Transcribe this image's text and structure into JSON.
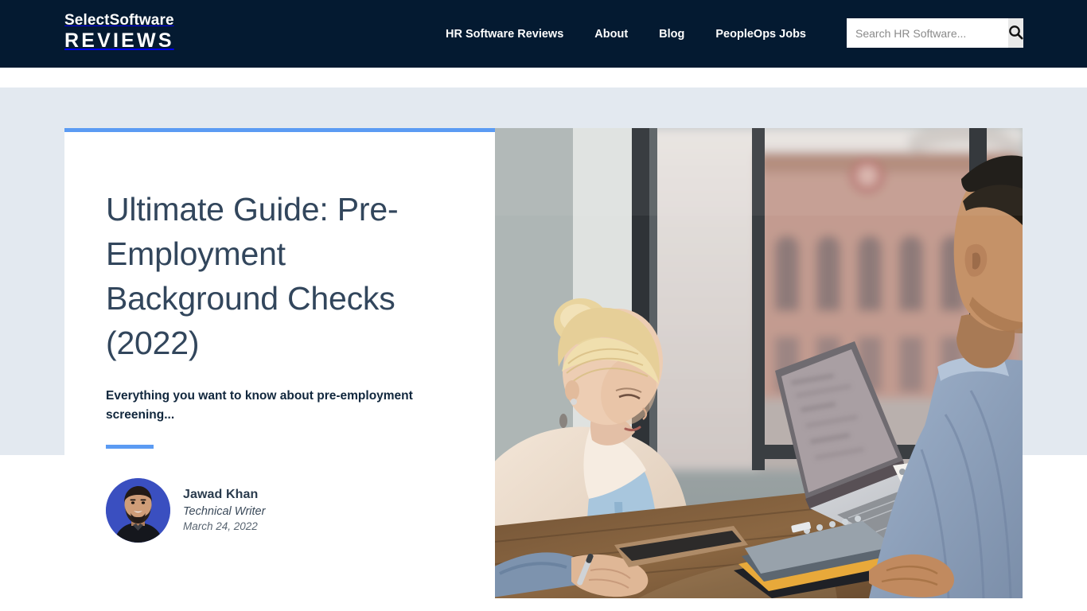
{
  "header": {
    "logo_line1": "SelectSoftware",
    "logo_line2": "REVIEWS",
    "nav": [
      {
        "label": "HR Software Reviews"
      },
      {
        "label": "About"
      },
      {
        "label": "Blog"
      },
      {
        "label": "PeopleOps Jobs"
      }
    ],
    "search": {
      "placeholder": "Search HR Software...",
      "value": "",
      "button_icon": "search-icon"
    },
    "background_color": "#041a31"
  },
  "hero": {
    "title": "Ultimate Guide: Pre-Employment Background Checks (2022)",
    "subtitle": "Everything you want to know about pre-employment screening...",
    "accent_color": "#5b9bf3",
    "band_color": "#e3e9f0",
    "author": {
      "name": "Jawad Khan",
      "role": "Technical Writer",
      "date": "March 24, 2022",
      "avatar_alt": "avatar-photo"
    },
    "image_alt": "two-colleagues-at-desk-with-laptop-by-window"
  }
}
